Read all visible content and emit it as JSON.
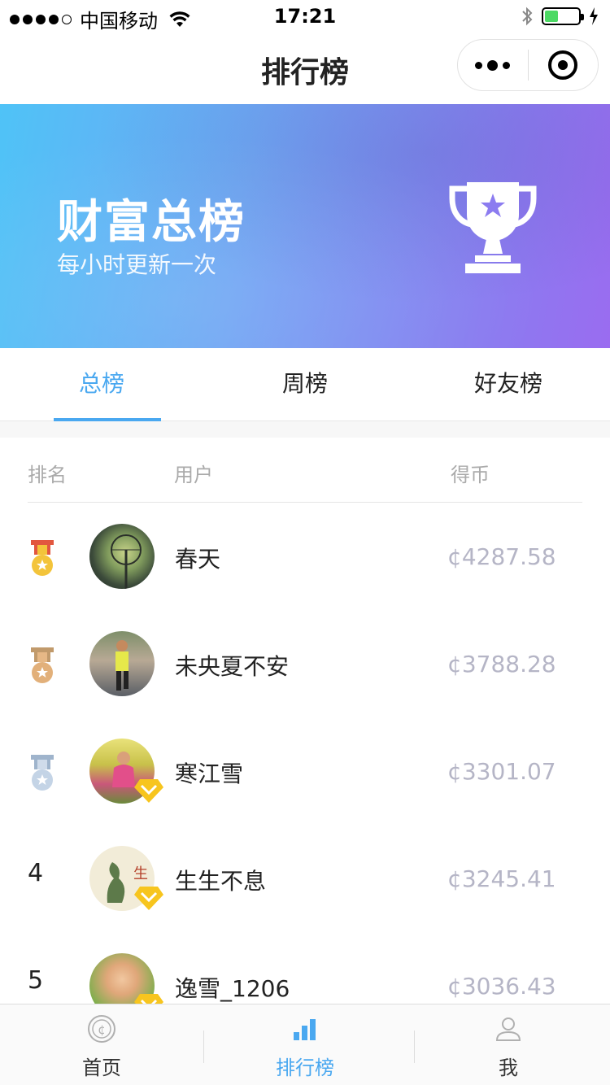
{
  "status_bar": {
    "carrier": "中国移动",
    "time": "17:21"
  },
  "nav": {
    "title": "排行榜"
  },
  "banner": {
    "title": "财富总榜",
    "subtitle": "每小时更新一次"
  },
  "tabs": [
    {
      "label": "总榜",
      "active": true
    },
    {
      "label": "周榜",
      "active": false
    },
    {
      "label": "好友榜",
      "active": false
    }
  ],
  "list_header": {
    "rank": "排名",
    "user": "用户",
    "coins": "得币"
  },
  "rows": [
    {
      "rank": "1",
      "name": "春天",
      "coins": "¢4287.58",
      "medal": "gold-medal-icon",
      "vip": false
    },
    {
      "rank": "2",
      "name": "未央夏不安",
      "coins": "¢3788.28",
      "medal": "bronze-medal-icon",
      "vip": false
    },
    {
      "rank": "3",
      "name": "寒江雪",
      "coins": "¢3301.07",
      "medal": "silver-medal-icon",
      "vip": true
    },
    {
      "rank": "4",
      "name": "生生不息",
      "coins": "¢3245.41",
      "medal": null,
      "vip": true
    },
    {
      "rank": "5",
      "name": "逸雪_1206",
      "coins": "¢3036.43",
      "medal": null,
      "vip": true
    }
  ],
  "tabbar": [
    {
      "label": "首页",
      "icon": "coin-icon",
      "active": false
    },
    {
      "label": "排行榜",
      "icon": "bar-chart-icon",
      "active": true
    },
    {
      "label": "我",
      "icon": "user-icon",
      "active": false
    }
  ],
  "colors": {
    "accent": "#4aa8f0",
    "coin_text": "#b5b5c6",
    "banner_start": "#4fc3f7",
    "banner_end": "#9a6cf0"
  }
}
